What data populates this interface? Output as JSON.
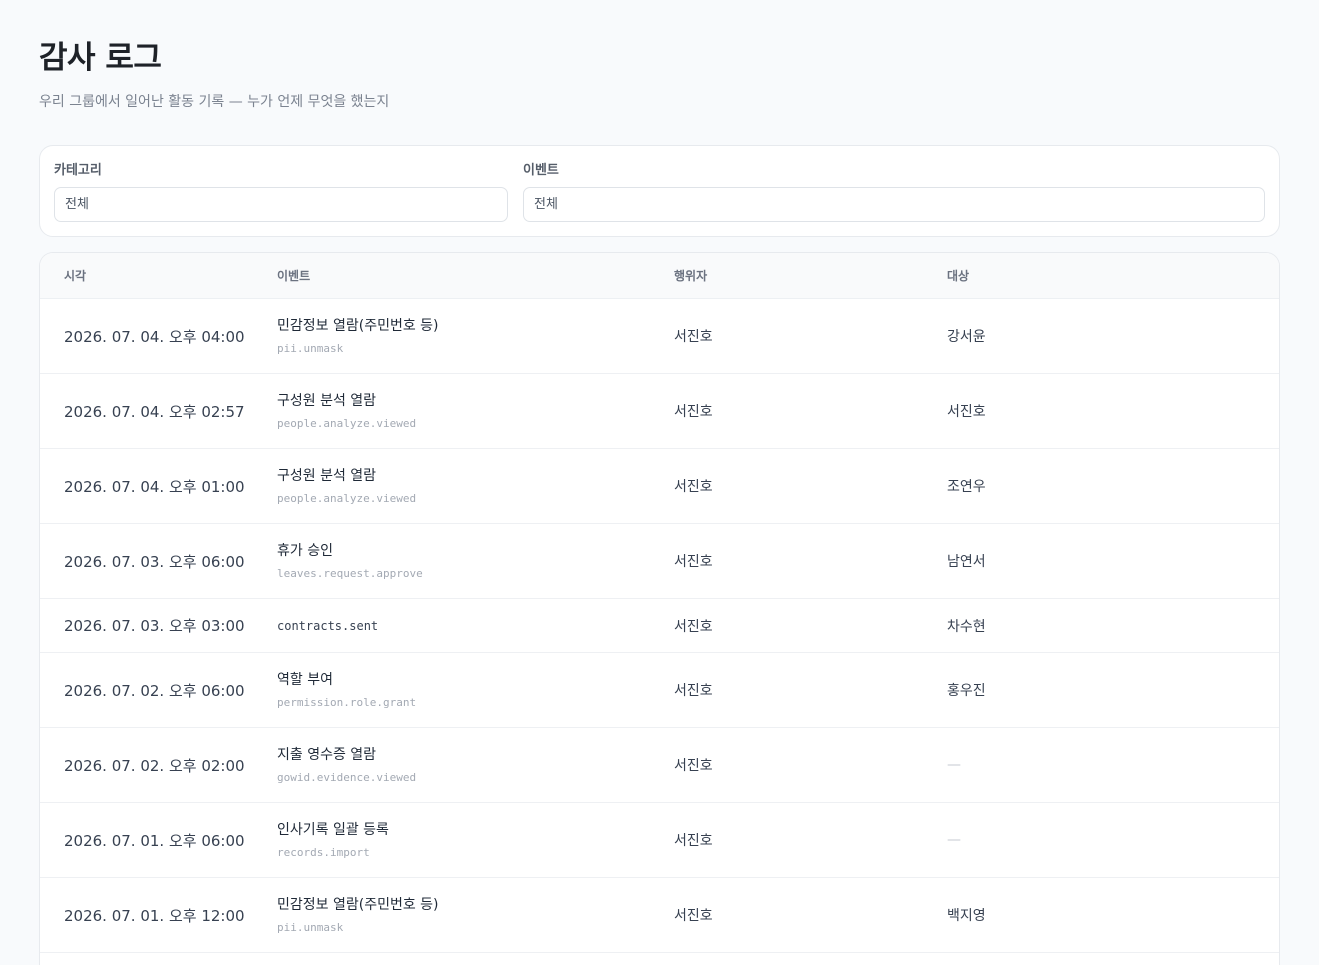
{
  "header": {
    "title": "감사 로그",
    "subtitle": "우리 그룹에서 일어난 활동 기록 — 누가 언제 무엇을 했는지"
  },
  "filters": {
    "category_label": "카테고리",
    "category_value": "전체",
    "event_label": "이벤트",
    "event_value": "전체"
  },
  "table": {
    "columns": [
      "시각",
      "이벤트",
      "행위자",
      "대상"
    ],
    "rows": [
      {
        "time": "2026. 07. 04. 오후 04:00",
        "event_label": "민감정보 열람(주민번호 등)",
        "event_code": "pii.unmask",
        "actor": "서진호",
        "target": "강서윤"
      },
      {
        "time": "2026. 07. 04. 오후 02:57",
        "event_label": "구성원 분석 열람",
        "event_code": "people.analyze.viewed",
        "actor": "서진호",
        "target": "서진호"
      },
      {
        "time": "2026. 07. 04. 오후 01:00",
        "event_label": "구성원 분석 열람",
        "event_code": "people.analyze.viewed",
        "actor": "서진호",
        "target": "조연우"
      },
      {
        "time": "2026. 07. 03. 오후 06:00",
        "event_label": "휴가 승인",
        "event_code": "leaves.request.approve",
        "actor": "서진호",
        "target": "남연서"
      },
      {
        "time": "2026. 07. 03. 오후 03:00",
        "event_label": "",
        "event_code": "contracts.sent",
        "actor": "서진호",
        "target": "차수현"
      },
      {
        "time": "2026. 07. 02. 오후 06:00",
        "event_label": "역할 부여",
        "event_code": "permission.role.grant",
        "actor": "서진호",
        "target": "홍우진"
      },
      {
        "time": "2026. 07. 02. 오후 02:00",
        "event_label": "지출 영수증 열람",
        "event_code": "gowid.evidence.viewed",
        "actor": "서진호",
        "target": "—"
      },
      {
        "time": "2026. 07. 01. 오후 06:00",
        "event_label": "인사기록 일괄 등록",
        "event_code": "records.import",
        "actor": "서진호",
        "target": "—"
      },
      {
        "time": "2026. 07. 01. 오후 12:00",
        "event_label": "민감정보 열람(주민번호 등)",
        "event_code": "pii.unmask",
        "actor": "서진호",
        "target": "백지영"
      }
    ]
  }
}
